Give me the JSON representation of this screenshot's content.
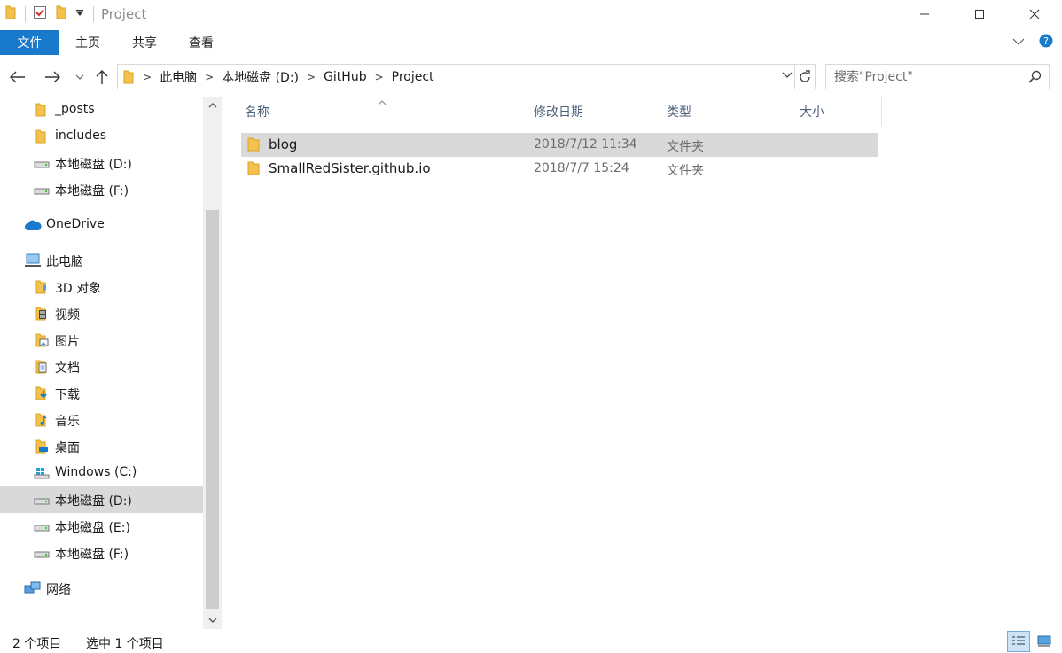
{
  "window": {
    "title": "Project"
  },
  "ribbon": {
    "tabs": [
      "文件",
      "主页",
      "共享",
      "查看"
    ]
  },
  "address": {
    "crumbs": [
      "此电脑",
      "本地磁盘 (D:)",
      "GitHub",
      "Project"
    ]
  },
  "search": {
    "placeholder": "搜索\"Project\""
  },
  "sidebar": {
    "items": [
      {
        "label": "_posts",
        "icon": "folder-icon"
      },
      {
        "label": "includes",
        "icon": "folder-icon"
      },
      {
        "label": "本地磁盘 (D:)",
        "icon": "drive-icon"
      },
      {
        "label": "本地磁盘 (F:)",
        "icon": "drive-icon"
      },
      {
        "label": "OneDrive",
        "icon": "cloud-icon"
      },
      {
        "label": "此电脑",
        "icon": "computer-icon"
      },
      {
        "label": "3D 对象",
        "icon": "3d-objects-icon"
      },
      {
        "label": "视频",
        "icon": "video-icon"
      },
      {
        "label": "图片",
        "icon": "pictures-icon"
      },
      {
        "label": "文档",
        "icon": "documents-icon"
      },
      {
        "label": "下载",
        "icon": "download-icon"
      },
      {
        "label": "音乐",
        "icon": "music-icon"
      },
      {
        "label": "桌面",
        "icon": "desktop-icon"
      },
      {
        "label": "Windows (C:)",
        "icon": "windows-drive-icon"
      },
      {
        "label": "本地磁盘 (D:)",
        "icon": "drive-icon",
        "selected": true
      },
      {
        "label": "本地磁盘 (E:)",
        "icon": "drive-icon"
      },
      {
        "label": "本地磁盘 (F:)",
        "icon": "drive-icon"
      },
      {
        "label": "网络",
        "icon": "network-icon"
      }
    ]
  },
  "list": {
    "columns": [
      "名称",
      "修改日期",
      "类型",
      "大小"
    ],
    "rows": [
      {
        "name": "blog",
        "date": "2018/7/12 11:34",
        "type": "文件夹",
        "selected": true
      },
      {
        "name": "SmallRedSister.github.io",
        "date": "2018/7/7 15:24",
        "type": "文件夹"
      }
    ]
  },
  "status": {
    "count": "2 个项目",
    "selection": "选中 1 个项目"
  },
  "colors": {
    "accent": "#1979ca",
    "selection": "#d9d9d9",
    "folder": "#f4c14f",
    "header_text": "#4c607a"
  }
}
